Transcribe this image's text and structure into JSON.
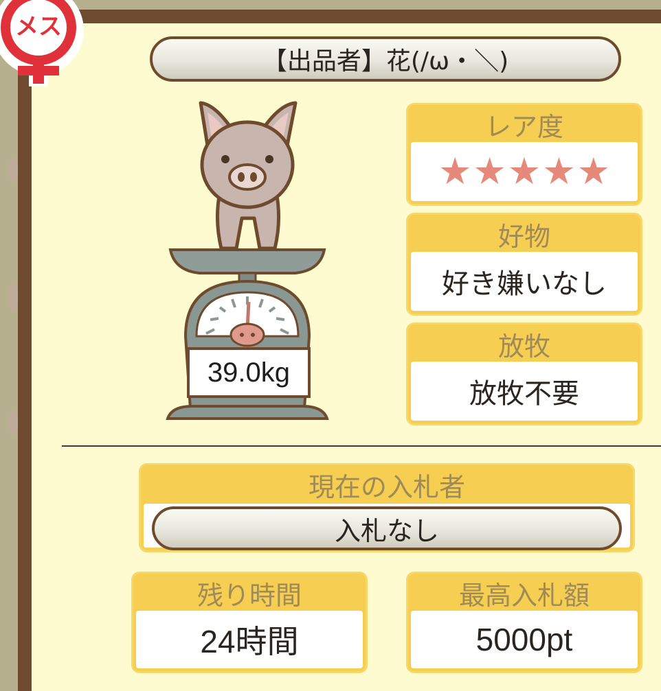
{
  "gender_badge": {
    "label": "メス",
    "color": "#e0303a"
  },
  "seller": {
    "text": "【出品者】花(/ω・＼)"
  },
  "weight": {
    "text": "39.0kg"
  },
  "rarity": {
    "label": "レア度",
    "stars": 5,
    "star_char": "★"
  },
  "favorite": {
    "label": "好物",
    "value": "好き嫌いなし"
  },
  "grazing": {
    "label": "放牧",
    "value": "放牧不要"
  },
  "current_bidder": {
    "label": "現在の入札者",
    "value": "入札なし"
  },
  "time_left": {
    "label": "残り時間",
    "value": "24時間"
  },
  "highest_bid": {
    "label": "最高入札額",
    "value": "5000pt"
  },
  "colors": {
    "frame": "#6e4b2e",
    "background": "#fdfbcf",
    "card_header": "#f6cf52",
    "star": "#e58a7a"
  }
}
